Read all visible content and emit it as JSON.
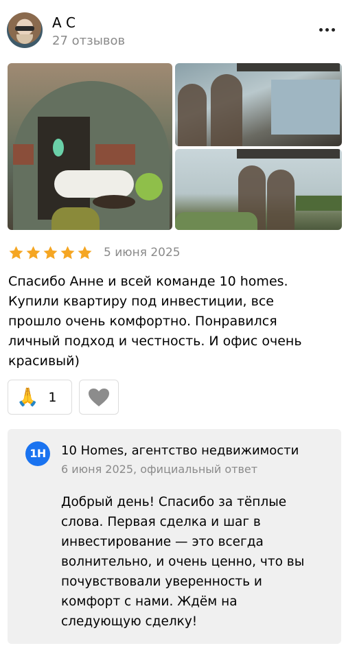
{
  "author": {
    "name": "А С",
    "reviews_count": "27 отзывов"
  },
  "menu": {
    "icon": "more-dots-icon"
  },
  "photos": [
    {
      "name": "review-photo-office-interior"
    },
    {
      "name": "review-photo-building-facade"
    },
    {
      "name": "review-photo-building-terrace"
    }
  ],
  "rating": {
    "value": 5,
    "max": 5,
    "star_color": "#f5a623"
  },
  "review": {
    "date": "5 июня 2025",
    "text": "Спасибо Анне и всей команде 10 homes.\nКупили квартиру под инвестиции, все\nпрошло очень комфортно. Понравился\nличный подход и честность. И офис очень\nкрасивый)"
  },
  "reactions": {
    "thanks_icon": "🙏",
    "thanks_count": "1",
    "like_icon": "heart-icon"
  },
  "reply": {
    "logo_text": "1H",
    "logo_color": "#1a73f0",
    "org_name": "10 Homes, агентство недвижимости",
    "meta": "6 июня 2025, официальный ответ",
    "text": "Добрый день! Спасибо за тёплые\nслова. Первая сделка и шаг в\nинвестирование — это всегда\nволнительно, и очень ценно, что вы\nпочувствовали уверенность и\nкомфорт с нами. Ждём на\nследующую сделку!"
  }
}
